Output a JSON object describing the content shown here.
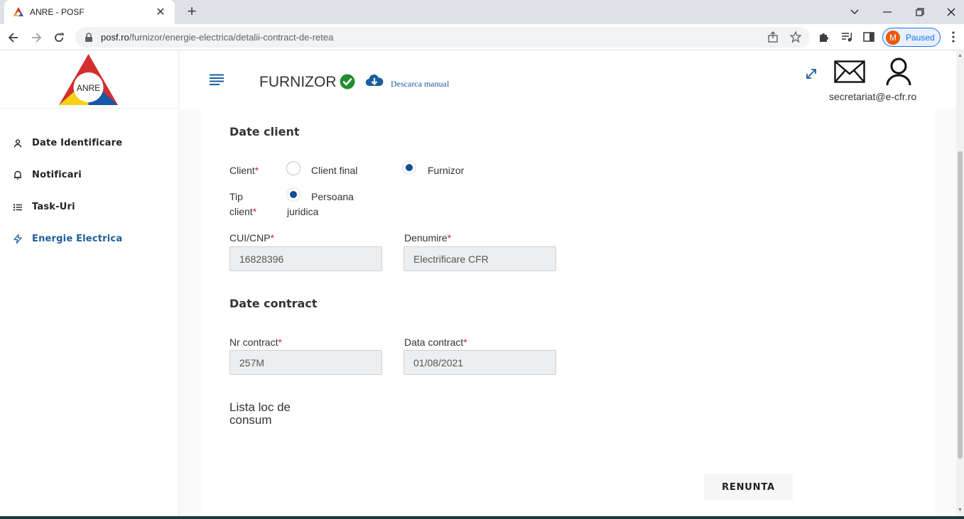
{
  "browser": {
    "tab_title": "ANRE - POSF",
    "url_host": "posf.ro",
    "url_path": "/furnizor/energie-electrica/detalii-contract-de-retea",
    "profile_initial": "M",
    "profile_state": "Paused"
  },
  "sidebar": {
    "logo_text": "ANRE",
    "items": [
      {
        "label": "Date Identificare",
        "icon": "person-icon"
      },
      {
        "label": "Notificari",
        "icon": "bell-icon"
      },
      {
        "label": "Task-Uri",
        "icon": "list-icon"
      },
      {
        "label": "Energie Electrica",
        "icon": "bolt-icon",
        "active": true
      }
    ]
  },
  "topbar": {
    "brand": "FURNIZOR",
    "manual_link": "Descarca manual",
    "user_email": "secretariat@e-cfr.ro"
  },
  "client": {
    "title": "Date client",
    "client_label": "Client",
    "option_final": "Client final",
    "option_furnizor": "Furnizor",
    "tip_label_line1": "Tip",
    "tip_label_line2": "client",
    "tip_option_line1": "Persoana",
    "tip_option_line2": "juridica",
    "cui_label": "CUI/CNP",
    "cui_value": "16828396",
    "denumire_label": "Denumire",
    "denumire_value": "Electrificare CFR",
    "required_mark": "*"
  },
  "contract": {
    "title": "Date contract",
    "nr_label": "Nr contract",
    "nr_value": "257M",
    "data_label": "Data contract",
    "data_value": "01/08/2021"
  },
  "lista": {
    "line1": "Lista loc de",
    "line2": "consum"
  },
  "actions": {
    "cancel": "RENUNTA"
  },
  "colors": {
    "accent": "#1b5e9c",
    "radio_selected": "#0d4f96",
    "success": "#1e8e2e",
    "required": "#c62828"
  }
}
